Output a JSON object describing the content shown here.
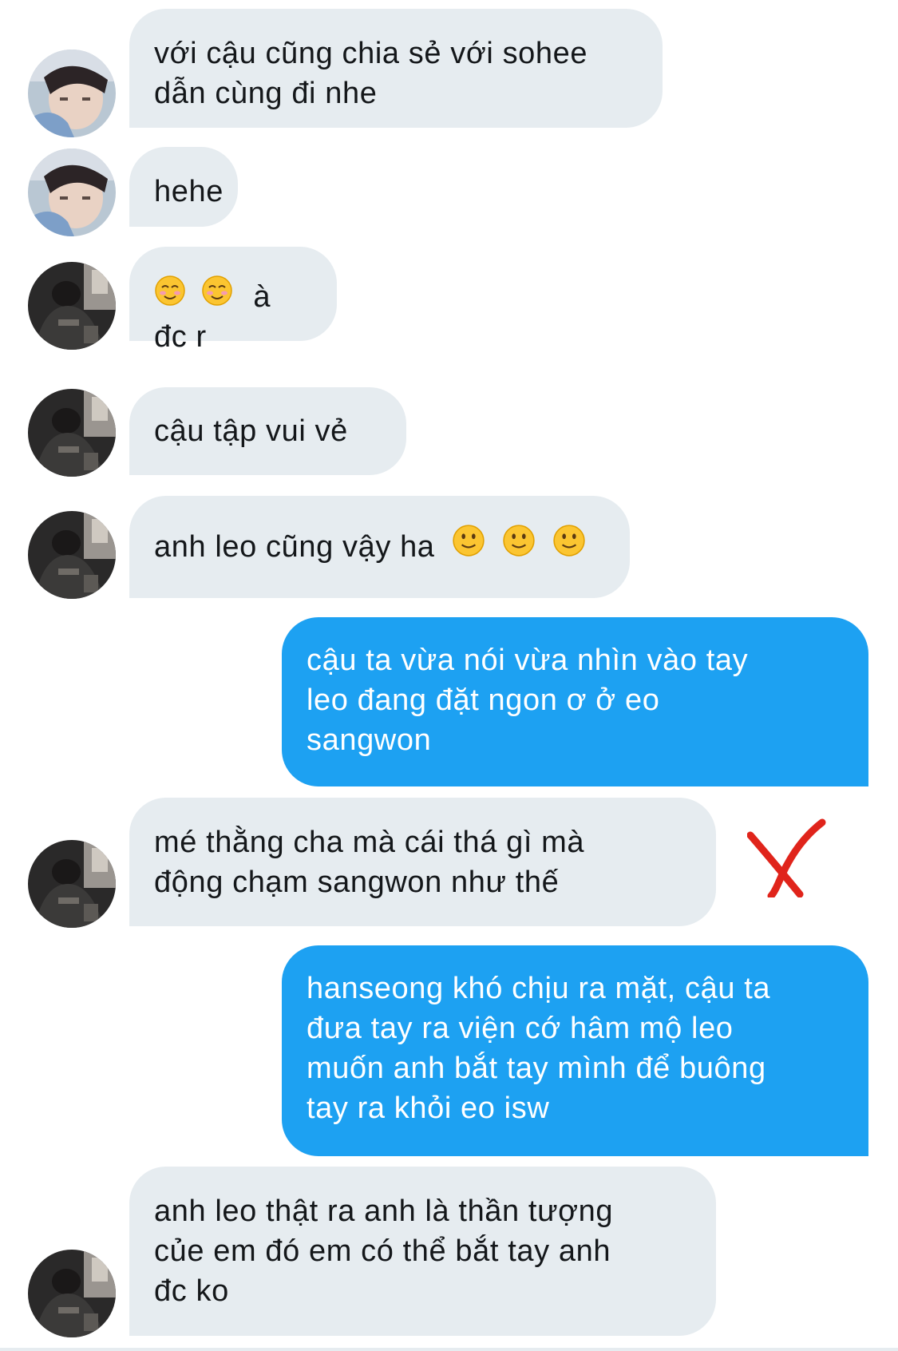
{
  "colors": {
    "incoming_bubble": "#e6ecf0",
    "outgoing_bubble": "#1da1f2",
    "cross_mark": "#e0241b"
  },
  "messages": [
    {
      "direction": "incoming",
      "avatar": "avatar-light",
      "lines": [
        "với cậu cũng chia sẻ với sohee",
        "dẫn cùng đi nhe"
      ]
    },
    {
      "direction": "incoming",
      "avatar": "avatar-light",
      "lines": [
        "hehe"
      ]
    },
    {
      "direction": "incoming",
      "avatar": "avatar-dark",
      "emoji_before": [
        "smiling-face-icon",
        "smiling-face-icon"
      ],
      "lines": [
        "à đc r"
      ]
    },
    {
      "direction": "incoming",
      "avatar": "avatar-dark",
      "lines": [
        "cậu tập vui vẻ"
      ]
    },
    {
      "direction": "incoming",
      "avatar": "avatar-dark",
      "emoji_after": [
        "slight-smile-icon",
        "slight-smile-icon",
        "slight-smile-icon"
      ],
      "lines": [
        "anh leo cũng vậy ha"
      ]
    },
    {
      "direction": "outgoing",
      "lines": [
        "cậu ta vừa nói vừa nhìn vào tay",
        "leo đang đặt ngon ơ ở eo",
        "sangwon"
      ]
    },
    {
      "direction": "incoming",
      "avatar": "avatar-dark",
      "marked": "cross-mark-icon",
      "lines": [
        "mé thằng cha mà cái thá gì mà",
        "động chạm sangwon như thế"
      ]
    },
    {
      "direction": "outgoing",
      "lines": [
        "hanseong khó chịu ra mặt, cậu ta",
        "đưa tay ra viện cớ hâm mộ leo",
        "muốn anh bắt tay mình để buông",
        "tay ra khỏi eo isw"
      ]
    },
    {
      "direction": "incoming",
      "avatar": "avatar-dark",
      "lines": [
        "anh leo thật ra anh là thần tượng",
        "củe em đó em có thể bắt tay anh",
        "đc ko"
      ]
    }
  ]
}
